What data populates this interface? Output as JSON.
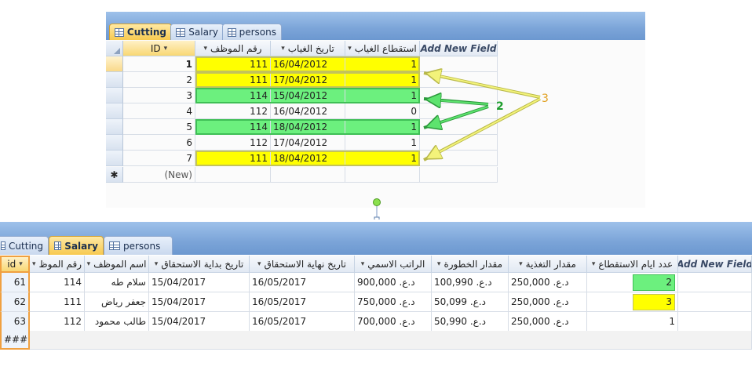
{
  "top": {
    "tabs": [
      {
        "label": "Cutting",
        "active": true
      },
      {
        "label": "Salary",
        "active": false
      },
      {
        "label": "persons",
        "active": false
      }
    ],
    "columns": [
      {
        "label": "ID"
      },
      {
        "label": "رقم الموظف"
      },
      {
        "label": "تاريخ الغياب"
      },
      {
        "label": "استقطاع الغياب"
      },
      {
        "label": "Add New Field"
      }
    ],
    "rows": [
      {
        "id": "1",
        "emp": "111",
        "date": "16/04/2012",
        "deduct": "1",
        "hl": "yellow"
      },
      {
        "id": "2",
        "emp": "111",
        "date": "17/04/2012",
        "deduct": "1",
        "hl": "yellow"
      },
      {
        "id": "3",
        "emp": "114",
        "date": "15/04/2012",
        "deduct": "1",
        "hl": "green"
      },
      {
        "id": "4",
        "emp": "112",
        "date": "16/04/2012",
        "deduct": "0",
        "hl": ""
      },
      {
        "id": "5",
        "emp": "114",
        "date": "18/04/2012",
        "deduct": "1",
        "hl": "green"
      },
      {
        "id": "6",
        "emp": "112",
        "date": "17/04/2012",
        "deduct": "1",
        "hl": ""
      },
      {
        "id": "7",
        "emp": "111",
        "date": "18/04/2012",
        "deduct": "1",
        "hl": "yellow"
      }
    ],
    "new_row": {
      "marker": "✱",
      "label": "(New)"
    }
  },
  "annotations": {
    "label_green": "2",
    "label_yellow": "3",
    "color_green": "#1e9e2e",
    "color_yellow": "#e0a020"
  },
  "bottom": {
    "tabs": [
      {
        "label": "Cutting",
        "active": false
      },
      {
        "label": "Salary",
        "active": true
      },
      {
        "label": "persons",
        "active": false
      }
    ],
    "columns": [
      {
        "label": "id"
      },
      {
        "label": "رقم الموظ"
      },
      {
        "label": "اسم الموظف"
      },
      {
        "label": "تاريخ بداية الاستحقاق"
      },
      {
        "label": "تاريخ نهاية الاستحقاق"
      },
      {
        "label": "الراتب الاسمي"
      },
      {
        "label": "مقدار الخطورة"
      },
      {
        "label": "مقدار التغذية"
      },
      {
        "label": "عدد ايام الاستقطاع"
      },
      {
        "label": "Add New Field"
      }
    ],
    "rows": [
      {
        "id": "61",
        "emp": "114",
        "name": "سلام طه",
        "start": "15/04/2017",
        "end": "16/05/2017",
        "salary": "د.ع. 900,000",
        "risk": "د.ع. 100,990",
        "food": "د.ع. 250,000",
        "days": "2",
        "hl": "green"
      },
      {
        "id": "62",
        "emp": "111",
        "name": "جعفر رياض",
        "start": "15/04/2017",
        "end": "16/05/2017",
        "salary": "د.ع. 750,000",
        "risk": "د.ع. 50,099",
        "food": "د.ع. 250,000",
        "days": "3",
        "hl": "yellow"
      },
      {
        "id": "63",
        "emp": "112",
        "name": "طالب محمود",
        "start": "15/04/2017",
        "end": "16/05/2017",
        "salary": "د.ع. 700,000",
        "risk": "د.ع. 50,990",
        "food": "د.ع. 250,000",
        "days": "1",
        "hl": ""
      }
    ],
    "new_row_id": "####"
  },
  "colors": {
    "yellow": "#ffff00",
    "green": "#6cf07e",
    "active_tab": "#f7c94f",
    "tab_strip": "#7ba4d8"
  }
}
